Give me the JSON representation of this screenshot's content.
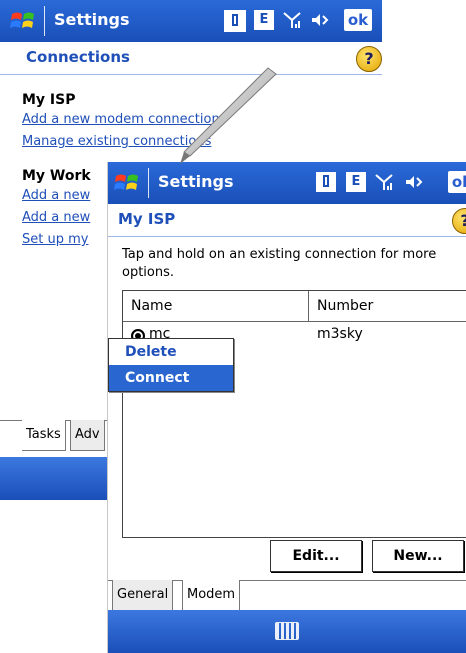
{
  "back_screen": {
    "title": "Settings",
    "status_icons": [
      "data-icon",
      "e-icon",
      "signal-icon",
      "speaker-icon"
    ],
    "ok_label": "ok",
    "subheader": "Connections",
    "my_isp": {
      "heading": "My ISP",
      "links": [
        "Add a new modem connection",
        "Manage existing connections"
      ]
    },
    "my_work": {
      "heading": "My Work",
      "links": [
        "Add a new",
        "Add a new",
        "Set up my"
      ]
    },
    "tabs": [
      "Tasks",
      "Adv"
    ]
  },
  "front_screen": {
    "title": "Settings",
    "ok_label": "ok",
    "subheader": "My ISP",
    "instructions": "Tap and hold on an existing connection for more options.",
    "list": {
      "columns": [
        "Name",
        "Number"
      ],
      "rows": [
        {
          "name": "mc",
          "number": "m3sky"
        }
      ]
    },
    "context_menu": {
      "items": [
        "Delete",
        "Connect"
      ],
      "selected": "Connect"
    },
    "buttons": {
      "edit": "Edit...",
      "new": "New..."
    },
    "tabs": [
      "General",
      "Modem"
    ],
    "active_tab": "Modem"
  },
  "colors": {
    "titlebar_blue": "#1a4fb8",
    "link_blue": "#1f4fb8",
    "selection_blue": "#2a66d0"
  }
}
